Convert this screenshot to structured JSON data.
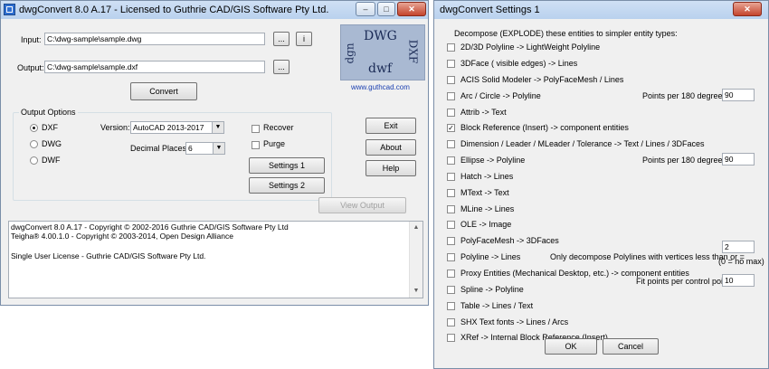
{
  "main": {
    "title": "dwgConvert 8.0 A.17 - Licensed to Guthrie CAD/GIS Software Pty Ltd.",
    "titlebar_buttons": {
      "minimize": "–",
      "maximize": "□",
      "close": "✕"
    },
    "input_label": "Input:",
    "input_value": "C:\\dwg-sample\\sample.dwg",
    "output_label": "Output:",
    "output_value": "C:\\dwg-sample\\sample.dxf",
    "browse_label": "...",
    "info_label": "i",
    "convert_label": "Convert",
    "logo": {
      "dwg": "DWG",
      "dxf": "DXF",
      "dwf": "dwf",
      "dgn": "dgn"
    },
    "link": "www.guthcad.com",
    "output_options": {
      "title": "Output Options",
      "formats": [
        {
          "label": "DXF",
          "selected": true
        },
        {
          "label": "DWG",
          "selected": false
        },
        {
          "label": "DWF",
          "selected": false
        }
      ],
      "version_label": "Version:",
      "version_value": "AutoCAD 2013-2017",
      "decimal_label": "Decimal Places:",
      "decimal_value": "6",
      "recover_label": "Recover",
      "purge_label": "Purge",
      "settings1_label": "Settings 1",
      "settings2_label": "Settings 2"
    },
    "exit_label": "Exit",
    "about_label": "About",
    "help_label": "Help",
    "view_output_label": "View Output",
    "log_lines": [
      "dwgConvert 8.0 A.17 - Copyright © 2002-2016 Guthrie CAD/GIS Software Pty Ltd",
      "Teigha® 4.00.1.0 - Copyright © 2003-2014, Open Design Alliance",
      "",
      "Single User License - Guthrie CAD/GIS Software Pty Ltd."
    ]
  },
  "settings": {
    "title": "dwgConvert Settings 1",
    "close": "✕",
    "heading": "Decompose (EXPLODE) these entities to simpler entity types:",
    "items": [
      {
        "label": "2D/3D Polyline -> LightWeight Polyline",
        "checked": false
      },
      {
        "label": "3DFace ( visible edges) -> Lines",
        "checked": false
      },
      {
        "label": "ACIS Solid Modeler -> PolyFaceMesh / Lines",
        "checked": false
      },
      {
        "label": "Arc / Circle -> Polyline",
        "checked": false
      },
      {
        "label": "Attrib -> Text",
        "checked": false
      },
      {
        "label": "Block Reference (Insert) -> component entities",
        "checked": true
      },
      {
        "label": "Dimension / Leader / MLeader / Tolerance -> Text / Lines / 3DFaces",
        "checked": false
      },
      {
        "label": "Ellipse -> Polyline",
        "checked": false
      },
      {
        "label": "Hatch -> Lines",
        "checked": false
      },
      {
        "label": "MText -> Text",
        "checked": false
      },
      {
        "label": "MLine -> Lines",
        "checked": false
      },
      {
        "label": "OLE -> Image",
        "checked": false
      },
      {
        "label": "PolyFaceMesh -> 3DFaces",
        "checked": false
      },
      {
        "label": "Polyline -> Lines",
        "checked": false
      },
      {
        "label": "Proxy Entities (Mechanical Desktop, etc.) -> component entities",
        "checked": false
      },
      {
        "label": "Spline -> Polyline",
        "checked": false
      },
      {
        "label": "Table -> Lines / Text",
        "checked": false
      },
      {
        "label": "SHX Text fonts -> Lines / Arcs",
        "checked": false
      },
      {
        "label": "XRef -> Internal Block Reference (Insert)",
        "checked": false
      }
    ],
    "arc_points_label": "Points per 180 degrees:",
    "arc_points_value": "90",
    "ellipse_points_label": "Points per 180 degrees:",
    "ellipse_points_value": "90",
    "polyline_vertices_label": "Only decompose Polylines with vertices less than or =",
    "polyline_vertices_value": "2",
    "no_max_note": "(0 = no max)",
    "spline_points_label": "Fit points per control point:",
    "spline_points_value": "10",
    "ok_label": "OK",
    "cancel_label": "Cancel"
  }
}
